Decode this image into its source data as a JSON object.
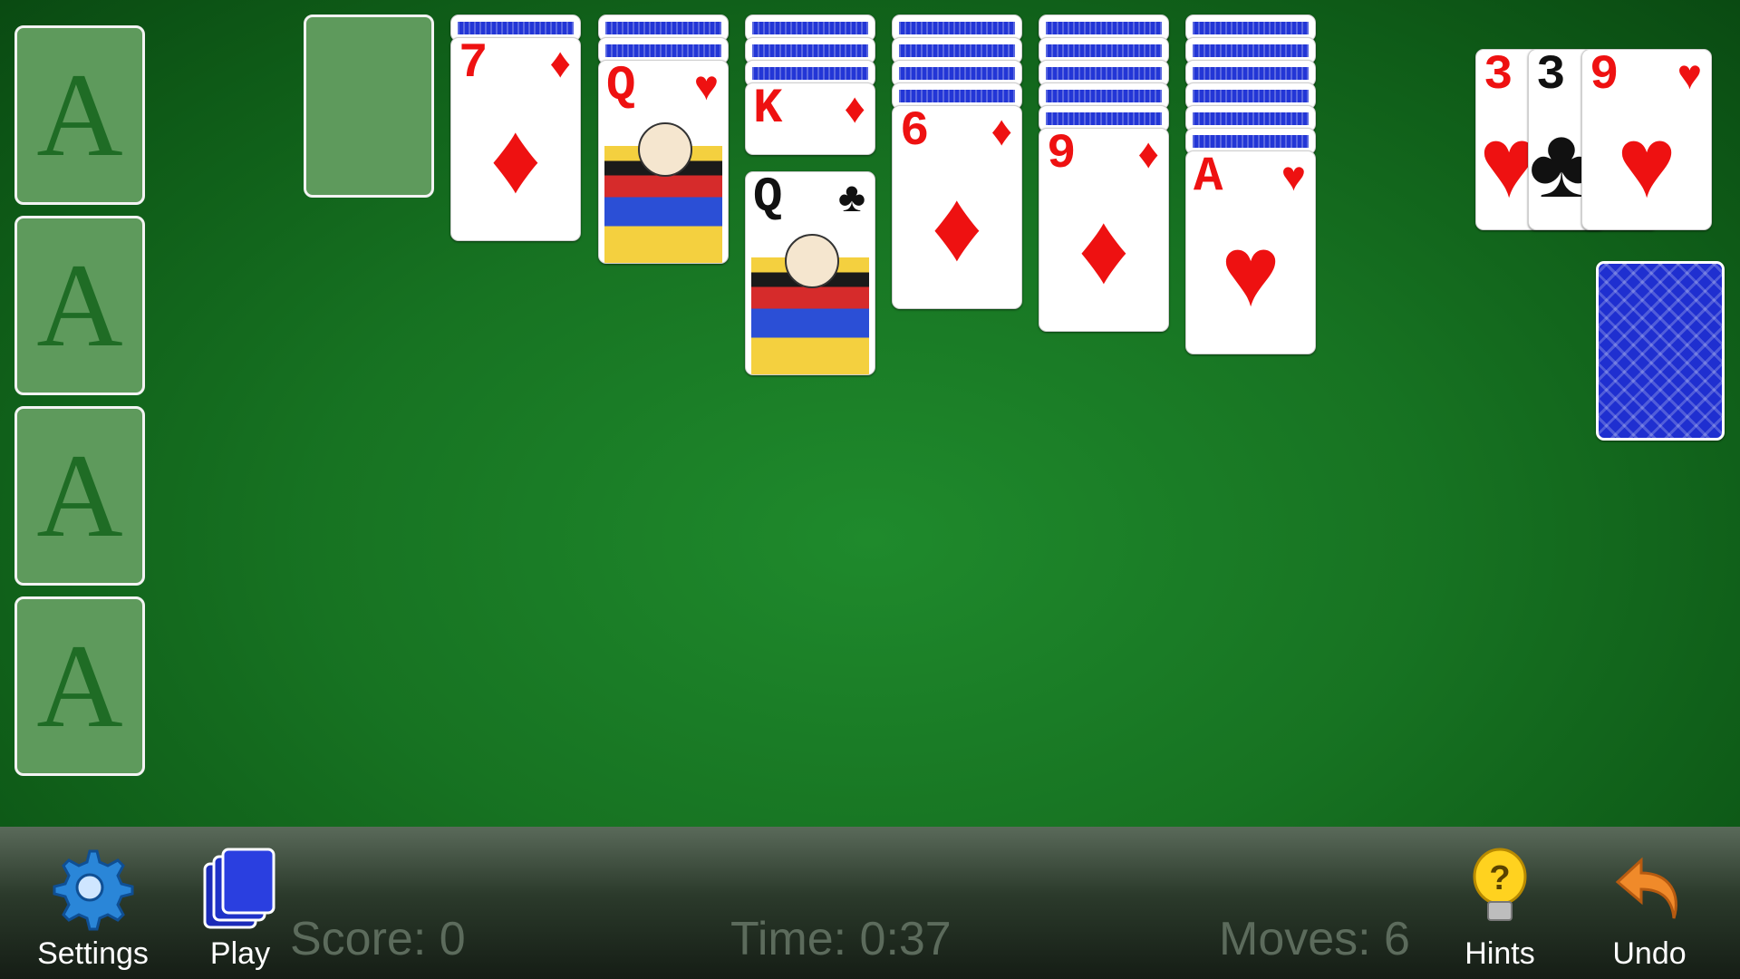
{
  "foundations": [
    "A",
    "A",
    "A",
    "A"
  ],
  "tableau": [
    {
      "face_down": 0,
      "faces": []
    },
    {
      "face_down": 1,
      "faces": [
        {
          "rank": "7",
          "suit": "♦",
          "color": "red"
        }
      ]
    },
    {
      "face_down": 2,
      "faces": [
        {
          "rank": "Q",
          "suit": "♥",
          "color": "red",
          "court": true
        }
      ]
    },
    {
      "face_down": 3,
      "faces": [
        {
          "rank": "K",
          "suit": "♦",
          "color": "red"
        },
        {
          "rank": "Q",
          "suit": "♣",
          "color": "black",
          "court": true
        }
      ]
    },
    {
      "face_down": 4,
      "faces": [
        {
          "rank": "6",
          "suit": "♦",
          "color": "red"
        }
      ]
    },
    {
      "face_down": 5,
      "faces": [
        {
          "rank": "9",
          "suit": "♦",
          "color": "red"
        }
      ]
    },
    {
      "face_down": 6,
      "faces": [
        {
          "rank": "A",
          "suit": "♥",
          "color": "red"
        }
      ]
    }
  ],
  "waste": [
    {
      "rank": "3",
      "suit": "♥",
      "color": "red"
    },
    {
      "rank": "3",
      "suit": "♣",
      "color": "black"
    },
    {
      "rank": "9",
      "suit": "♥",
      "color": "red"
    }
  ],
  "toolbar": {
    "settings_label": "Settings",
    "play_label": "Play",
    "score_text": "Score: 0",
    "time_text": "Time: 0:37",
    "moves_text": "Moves: 6",
    "hints_label": "Hints",
    "undo_label": "Undo"
  },
  "icons": {
    "settings": "gear-icon",
    "play": "cards-icon",
    "hints": "lightbulb-icon",
    "undo": "undo-arrow-icon"
  }
}
